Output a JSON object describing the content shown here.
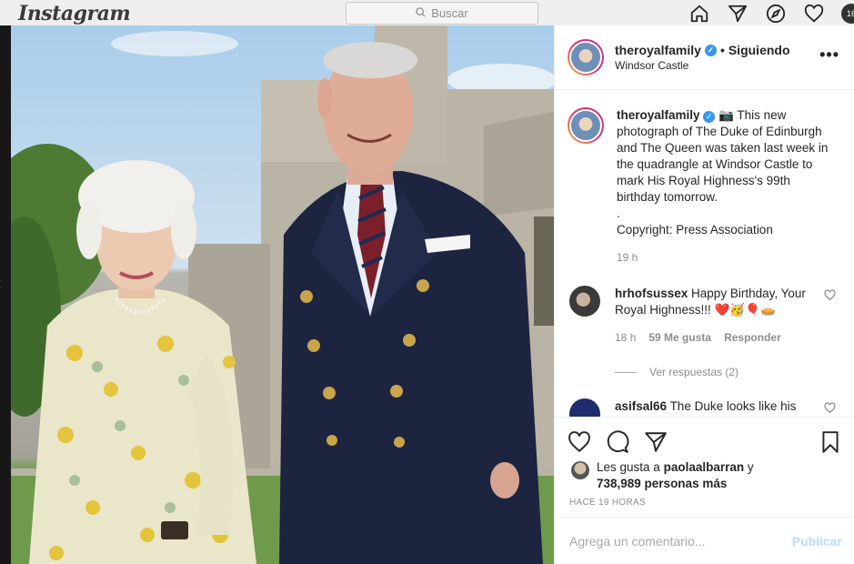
{
  "topbar": {
    "logo": "Instagram",
    "search_placeholder": "Buscar",
    "avatar_text": "16"
  },
  "post": {
    "username": "theroyalfamily",
    "separator": "•",
    "follow_status": "Siguiendo",
    "location": "Windsor Castle",
    "more_label": "•••"
  },
  "caption": {
    "username": "theroyalfamily",
    "text_1": "📷 This new photograph of The Duke of Edinburgh and The Queen was taken last week in the quadrangle at Windsor Castle to mark His Royal Highness's 99th birthday tomorrow.",
    "text_2": ".",
    "text_3": "Copyright: Press Association",
    "time": "19 h"
  },
  "comments": [
    {
      "username": "hrhofsussex",
      "text": "Happy Birthday, Your Royal Highness!!! ❤️🥳🎈🥧",
      "time": "18 h",
      "likes": "59 Me gusta",
      "reply": "Responder",
      "view_replies": "Ver respuestas (2)"
    },
    {
      "username": "asifsal66",
      "text": "The Duke looks like his"
    }
  ],
  "likes": {
    "prefix": "Les gusta a",
    "user": "paolaalbarran",
    "joiner": "y",
    "count": "738,989 personas más"
  },
  "timestamp": "HACE 19 HORAS",
  "add_comment": {
    "placeholder": "Agrega un comentario...",
    "publish": "Publicar"
  },
  "colors": {
    "verified": "#3897f0",
    "publish_disabled": "#b2dffc",
    "secondary_text": "#8e8e8e"
  }
}
